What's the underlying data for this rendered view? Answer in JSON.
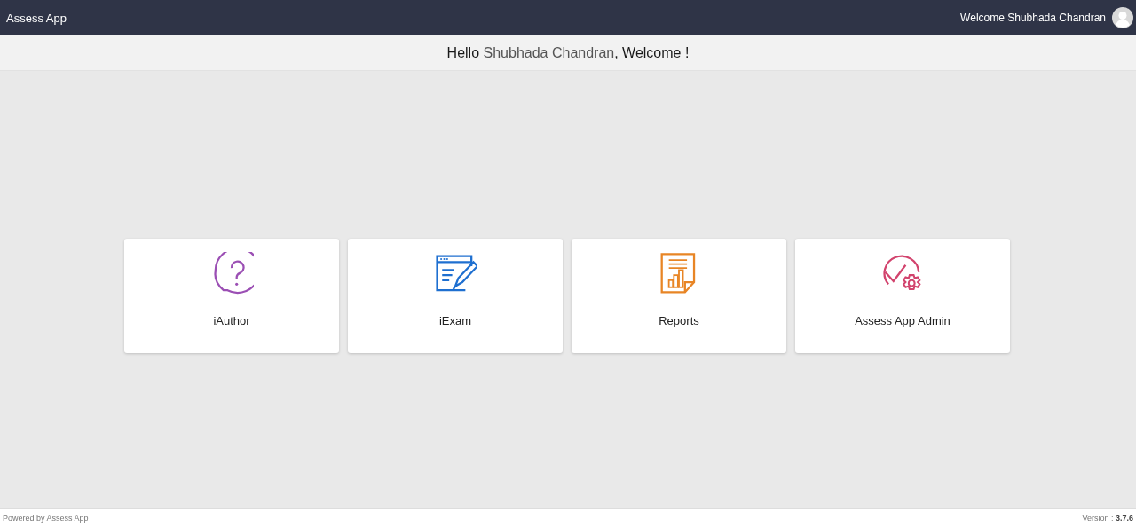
{
  "header": {
    "app_title": "Assess App",
    "welcome_text": "Welcome Shubhada Chandran"
  },
  "greeting": {
    "parts": [
      {
        "text": "Hello ",
        "kind": "plain"
      },
      {
        "text": "Shubhada Chandran",
        "kind": "name"
      },
      {
        "text": ", Welcome !",
        "kind": "plain"
      }
    ]
  },
  "apps": [
    {
      "label": "iAuthor",
      "kind": "author"
    },
    {
      "label": "iExam",
      "kind": "exam"
    },
    {
      "label": "Reports",
      "kind": "reports"
    },
    {
      "label": "Assess App Admin",
      "kind": "admin"
    }
  ],
  "footer": {
    "powered_by": "Powered by Assess App",
    "version": "Version : **3.7.6**"
  }
}
